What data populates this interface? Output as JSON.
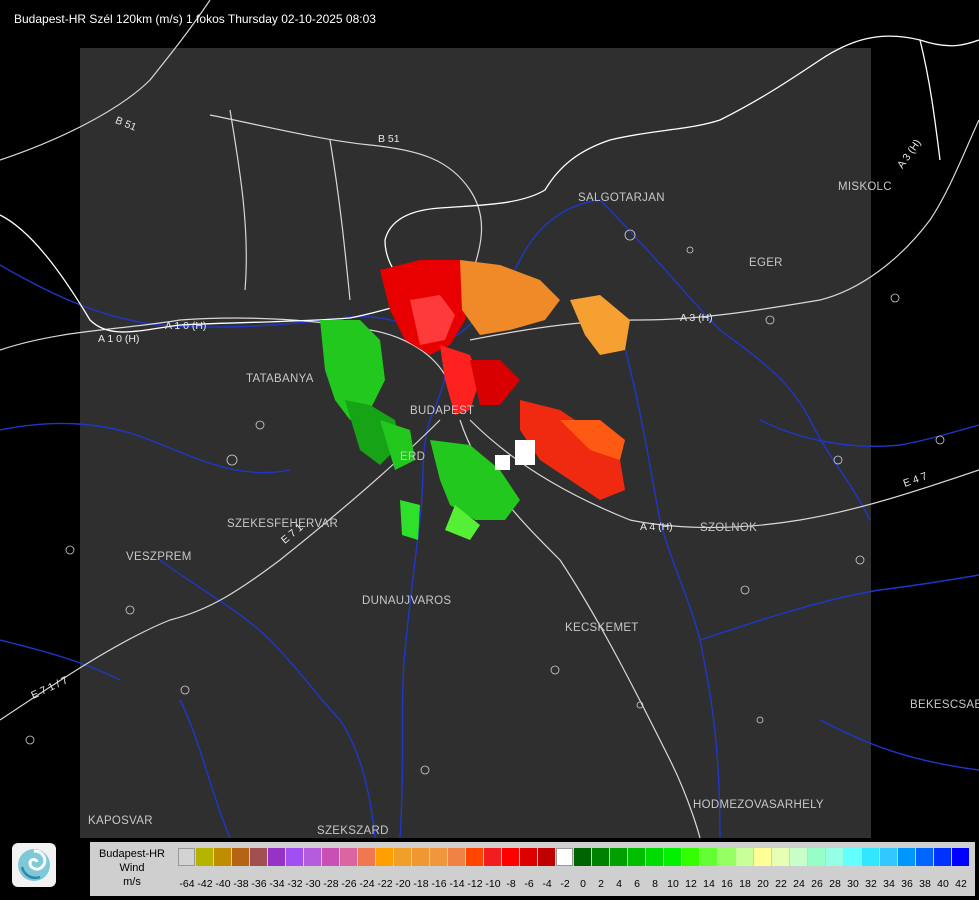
{
  "header": {
    "title": "Budapest-HR Szél 120km (m/s) 1 fokos Thursday 02-10-2025 08:03"
  },
  "map": {
    "cities": [
      "SALGOTARJAN",
      "MISKOLC",
      "EGER",
      "TATABANYA",
      "BUDAPEST",
      "ERD",
      "SZEKESFEHERVAR",
      "VESZPREM",
      "DUNAUJVAROS",
      "KECSKEMET",
      "SZOLNOK",
      "BEKESCSABA",
      "HODMEZOVASARHELY",
      "KAPOSVAR",
      "SZEKSZARD"
    ],
    "roads": [
      "B 51",
      "B 51",
      "A 1 0 (H)",
      "A 1 0 (H)",
      "A 3 (H)",
      "A 3 (H)",
      "A 4 (H)",
      "E 4 7",
      "E 7 1",
      "E 7 1 / 7"
    ],
    "colors": {
      "background": "#000000",
      "radar_area": "#2f2f2f",
      "roads": "#e6e6e6",
      "rivers": "#1f37c8",
      "borders": "#ffffff"
    }
  },
  "legend": {
    "title_lines": [
      "Budapest-HR",
      "Wind",
      "m/s"
    ],
    "ticks": [
      "-64",
      "-42",
      "-40",
      "-38",
      "-36",
      "-34",
      "-32",
      "-30",
      "-28",
      "-26",
      "-24",
      "-22",
      "-20",
      "-18",
      "-16",
      "-14",
      "-12",
      "-10",
      "-8",
      "-6",
      "-4",
      "-2",
      "0",
      "2",
      "4",
      "6",
      "8",
      "10",
      "12",
      "14",
      "16",
      "18",
      "20",
      "22",
      "24",
      "26",
      "28",
      "30",
      "32",
      "34",
      "36",
      "38",
      "40",
      "42"
    ],
    "colors": [
      "#d3d3d3",
      "#b4b400",
      "#c08c00",
      "#b46414",
      "#a05050",
      "#9632c8",
      "#a050f0",
      "#b45adc",
      "#c850b4",
      "#dc64a0",
      "#f07850",
      "#ffa000",
      "#f0a028",
      "#f09632",
      "#f0963c",
      "#f08246",
      "#ff4600",
      "#f01e1e",
      "#ff0000",
      "#dc0000",
      "#be0000",
      "#ffffff",
      "#006400",
      "#008200",
      "#00a000",
      "#00be00",
      "#00dc00",
      "#00f000",
      "#32ff00",
      "#64ff32",
      "#96ff64",
      "#c8ff96",
      "#ffff96",
      "#e6ffb4",
      "#c8ffc8",
      "#96ffc8",
      "#96ffe6",
      "#64ffff",
      "#32e6ff",
      "#32c8ff",
      "#0096ff",
      "#0064ff",
      "#0032ff",
      "#0000ff"
    ]
  },
  "icons": {
    "logo": "omsz-swirl-logo"
  }
}
